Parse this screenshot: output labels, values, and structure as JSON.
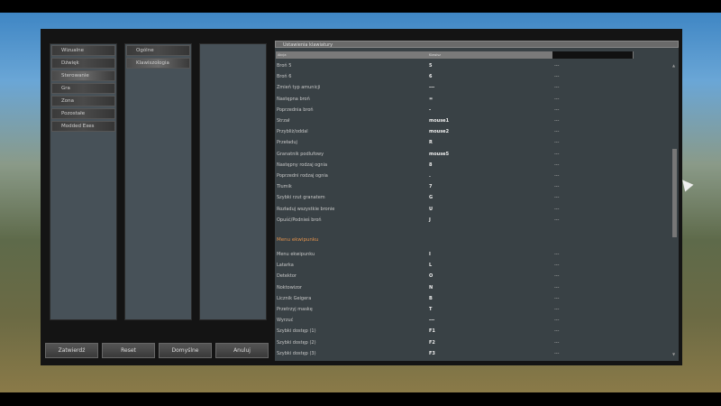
{
  "nav": {
    "categories": [
      "Wizualne",
      "Dźwięk",
      "Sterowanie",
      "Gra",
      "Zona",
      "Pozostałe",
      "Modded Exes"
    ],
    "active_category": 2,
    "subcategories": [
      "Ogólne",
      "Klawiszologia"
    ],
    "active_sub": 1
  },
  "buttons": {
    "confirm": "Zatwierdź",
    "reset": "Reset",
    "defaults": "Domyślne",
    "cancel": "Anuluj"
  },
  "panel": {
    "title": "Ustawienia klawiatury",
    "col_action": "Akcja",
    "col_key": "Klawisz",
    "rows": [
      {
        "a": "Broń 5",
        "k": "5",
        "b": "---"
      },
      {
        "a": "Broń 6",
        "k": "6",
        "b": "---"
      },
      {
        "a": "Zmień typ amunicji",
        "k": "---",
        "b": "---"
      },
      {
        "a": "Następna broń",
        "k": "=",
        "b": "---"
      },
      {
        "a": "Poprzednia broń",
        "k": "-",
        "b": "---"
      },
      {
        "a": "Strzał",
        "k": "mouse1",
        "b": "---"
      },
      {
        "a": "Przybliż/oddal",
        "k": "mouse2",
        "b": "---"
      },
      {
        "a": "Przeładuj",
        "k": "R",
        "b": "---"
      },
      {
        "a": "Granatnik podlufowy",
        "k": "mouse5",
        "b": "---"
      },
      {
        "a": "Następny rodzaj ognia",
        "k": "8",
        "b": "---"
      },
      {
        "a": "Poprzedni rodzaj ognia",
        "k": ".",
        "b": "---"
      },
      {
        "a": "Tłumik",
        "k": "7",
        "b": "---"
      },
      {
        "a": "Szybki rzut granatem",
        "k": "G",
        "b": "---"
      },
      {
        "a": "Rozładuj wszystkie bronie",
        "k": "U",
        "b": "---"
      },
      {
        "a": "Opuść/Podnieś broń",
        "k": "J",
        "b": "---"
      }
    ],
    "section2": "Menu ekwipunku",
    "rows2": [
      {
        "a": "Menu ekwipunku",
        "k": "I",
        "b": "---"
      },
      {
        "a": "Latarka",
        "k": "L",
        "b": "---"
      },
      {
        "a": "Detektor",
        "k": "O",
        "b": "---"
      },
      {
        "a": "Noktowizor",
        "k": "N",
        "b": "---"
      },
      {
        "a": "Licznik Geigera",
        "k": "B",
        "b": "---"
      },
      {
        "a": "Przetrzyj maskę",
        "k": "T",
        "b": "---"
      },
      {
        "a": "Wyrzuć",
        "k": "---",
        "b": "---"
      },
      {
        "a": "Szybki dostęp (1)",
        "k": "F1",
        "b": "---"
      },
      {
        "a": "Szybki dostęp (2)",
        "k": "F2",
        "b": "---"
      },
      {
        "a": "Szybki dostęp (3)",
        "k": "F3",
        "b": "---"
      }
    ]
  }
}
